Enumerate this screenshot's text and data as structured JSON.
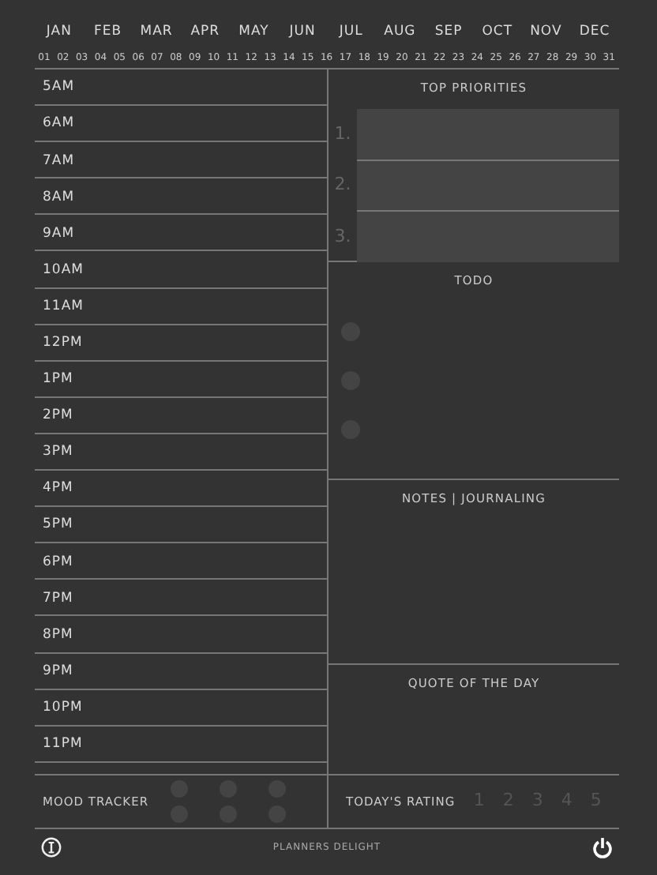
{
  "months": [
    {
      "label": "JAN",
      "selected": false
    },
    {
      "label": "FEB",
      "selected": false
    },
    {
      "label": "MAR",
      "selected": false
    },
    {
      "label": "APR",
      "selected": false
    },
    {
      "label": "MAY",
      "selected": false
    },
    {
      "label": "JUN",
      "selected": false
    },
    {
      "label": "JUL",
      "selected": false
    },
    {
      "label": "AUG",
      "selected": false
    },
    {
      "label": "SEP",
      "selected": false
    },
    {
      "label": "OCT",
      "selected": false
    },
    {
      "label": "NOV",
      "selected": false
    },
    {
      "label": "DEC",
      "selected": false
    }
  ],
  "days": [
    {
      "label": "01",
      "selected": false
    },
    {
      "label": "02",
      "selected": false
    },
    {
      "label": "03",
      "selected": false
    },
    {
      "label": "04",
      "selected": false
    },
    {
      "label": "05",
      "selected": false
    },
    {
      "label": "06",
      "selected": false
    },
    {
      "label": "07",
      "selected": false
    },
    {
      "label": "08",
      "selected": false
    },
    {
      "label": "09",
      "selected": false
    },
    {
      "label": "10",
      "selected": false
    },
    {
      "label": "11",
      "selected": false
    },
    {
      "label": "12",
      "selected": false
    },
    {
      "label": "13",
      "selected": false
    },
    {
      "label": "14",
      "selected": false
    },
    {
      "label": "15",
      "selected": false
    },
    {
      "label": "16",
      "selected": false
    },
    {
      "label": "17",
      "selected": false
    },
    {
      "label": "18",
      "selected": false
    },
    {
      "label": "19",
      "selected": false
    },
    {
      "label": "20",
      "selected": false
    },
    {
      "label": "21",
      "selected": false
    },
    {
      "label": "22",
      "selected": false
    },
    {
      "label": "23",
      "selected": false
    },
    {
      "label": "24",
      "selected": false
    },
    {
      "label": "25",
      "selected": false
    },
    {
      "label": "26",
      "selected": false
    },
    {
      "label": "27",
      "selected": false
    },
    {
      "label": "28",
      "selected": false
    },
    {
      "label": "29",
      "selected": false
    },
    {
      "label": "30",
      "selected": false
    },
    {
      "label": "31",
      "selected": false
    }
  ],
  "hours": [
    "5AM",
    "6AM",
    "7AM",
    "8AM",
    "9AM",
    "10AM",
    "11AM",
    "12PM",
    "1PM",
    "2PM",
    "3PM",
    "4PM",
    "5PM",
    "6PM",
    "7PM",
    "8PM",
    "9PM",
    "10PM",
    "11PM"
  ],
  "top_priorities": {
    "title": "TOP PRIORITIES",
    "items": [
      "1.",
      "2.",
      "3."
    ]
  },
  "todo": {
    "title": "TODO",
    "items": [
      {
        "checked": false
      },
      {
        "checked": false
      },
      {
        "checked": false
      }
    ]
  },
  "notes": {
    "title": "NOTES | JOURNALING"
  },
  "quote": {
    "title": "QUOTE OF THE DAY"
  },
  "mood_tracker": {
    "label": "MOOD TRACKER",
    "moods": [
      {
        "selected": false
      },
      {
        "selected": false
      },
      {
        "selected": false
      },
      {
        "selected": false
      },
      {
        "selected": false
      },
      {
        "selected": false
      }
    ]
  },
  "rating": {
    "label": "TODAY'S RATING",
    "options": [
      {
        "label": "1",
        "selected": false
      },
      {
        "label": "2",
        "selected": false
      },
      {
        "label": "3",
        "selected": false
      },
      {
        "label": "4",
        "selected": false
      },
      {
        "label": "5",
        "selected": false
      }
    ]
  },
  "footer": {
    "title": "PLANNERS DELIGHT"
  }
}
